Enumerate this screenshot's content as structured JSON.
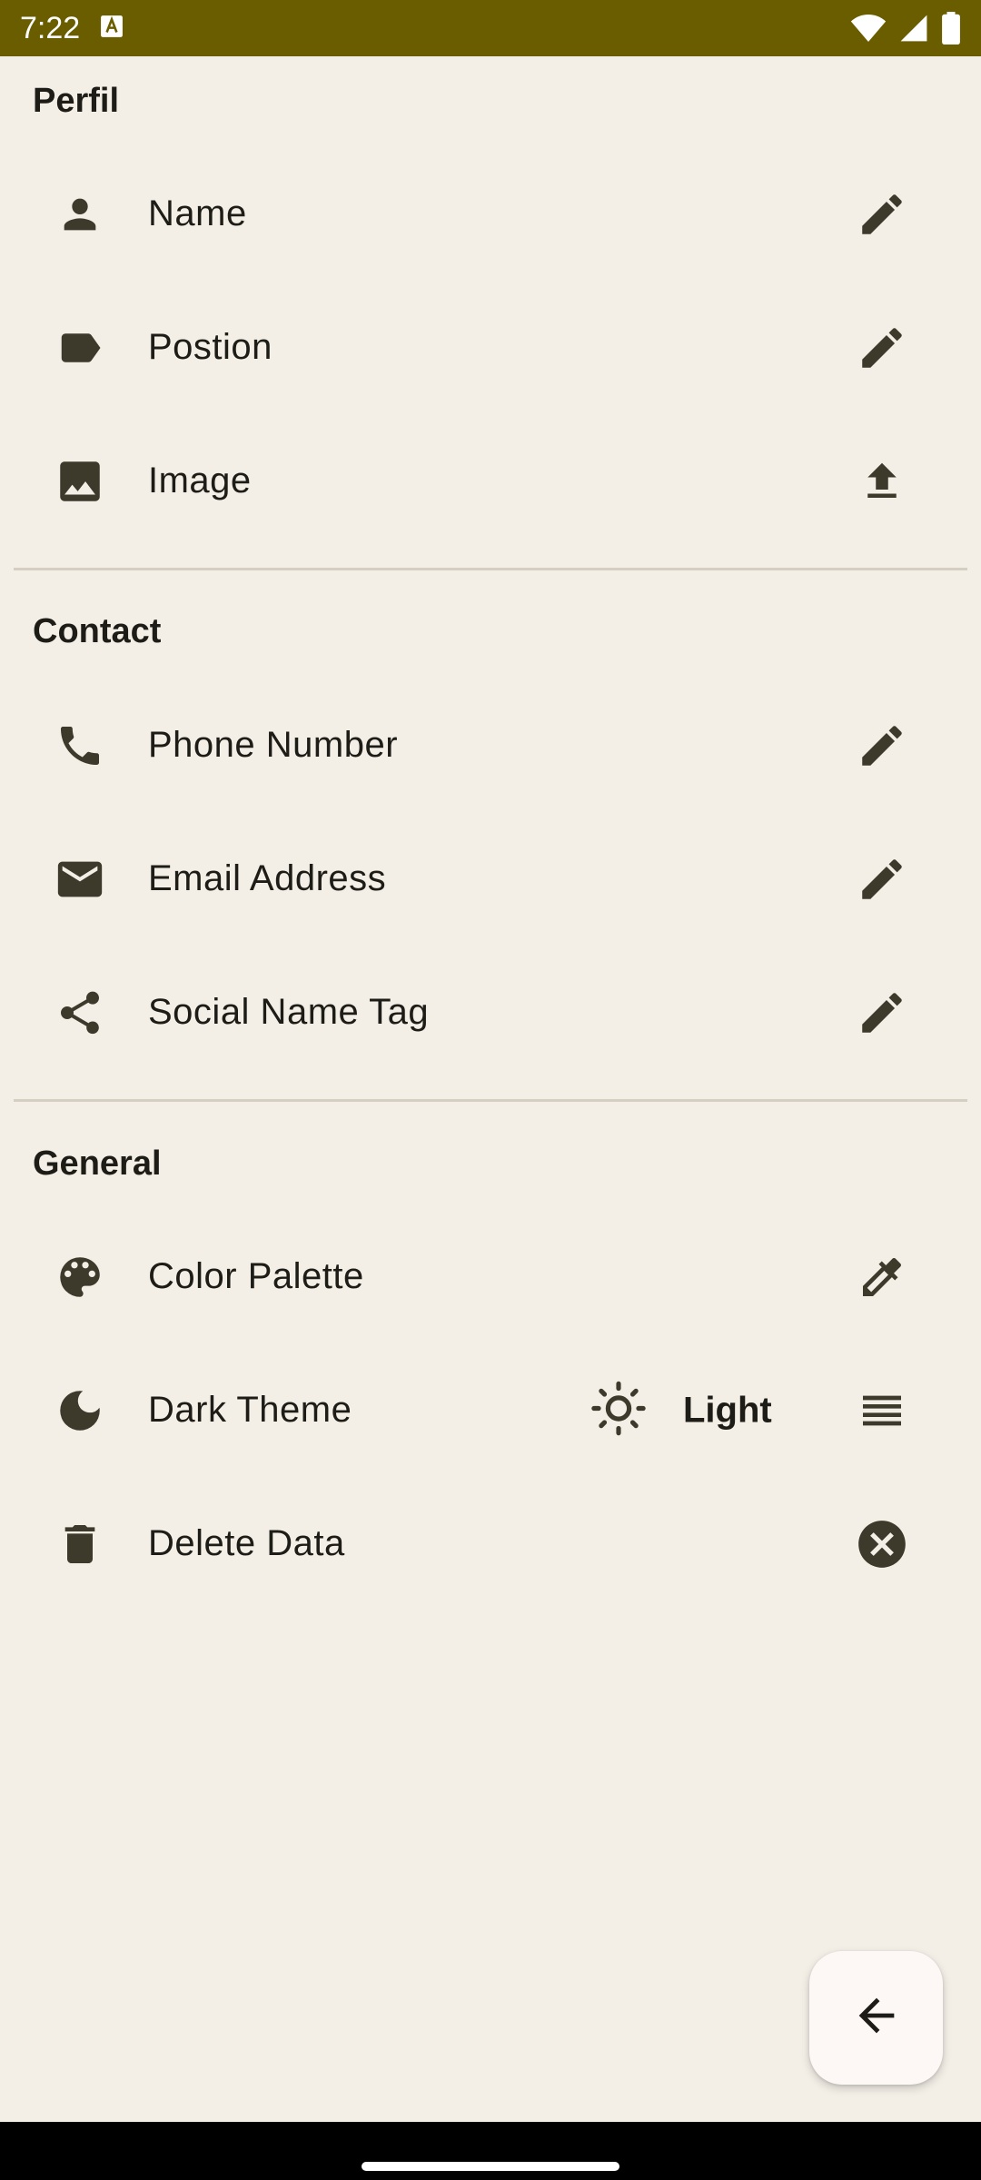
{
  "status_bar": {
    "time": "7:22",
    "background": "#6a5d00",
    "icons": [
      "notification-a-icon",
      "wifi-icon",
      "signal-icon",
      "battery-icon"
    ]
  },
  "sections": {
    "perfil": {
      "title": "Perfil",
      "items": [
        {
          "label": "Name",
          "icon": "person-icon",
          "action": "edit-icon"
        },
        {
          "label": "Postion",
          "icon": "label-icon",
          "action": "edit-icon"
        },
        {
          "label": "Image",
          "icon": "image-icon",
          "action": "upload-icon"
        }
      ]
    },
    "contact": {
      "title": "Contact",
      "items": [
        {
          "label": "Phone Number",
          "icon": "phone-icon",
          "action": "edit-icon"
        },
        {
          "label": "Email Address",
          "icon": "email-icon",
          "action": "edit-icon"
        },
        {
          "label": "Social Name Tag",
          "icon": "share-icon",
          "action": "edit-icon"
        }
      ]
    },
    "general": {
      "title": "General",
      "items": [
        {
          "label": "Color Palette",
          "icon": "palette-icon",
          "action": "colorize-icon"
        },
        {
          "label": "Dark Theme",
          "icon": "moon-icon",
          "action": "menu-icon",
          "value_icon": "sun-icon",
          "value": "Light"
        },
        {
          "label": "Delete Data",
          "icon": "trash-icon",
          "action": "cancel-icon"
        }
      ]
    }
  },
  "fab": {
    "icon": "arrow-back-icon"
  },
  "colors": {
    "background": "#f3efe7",
    "icon": "#3d3a2c",
    "text": "#1d1c16",
    "divider": "#d4cfc2",
    "fab_background": "#fdf8f6"
  }
}
